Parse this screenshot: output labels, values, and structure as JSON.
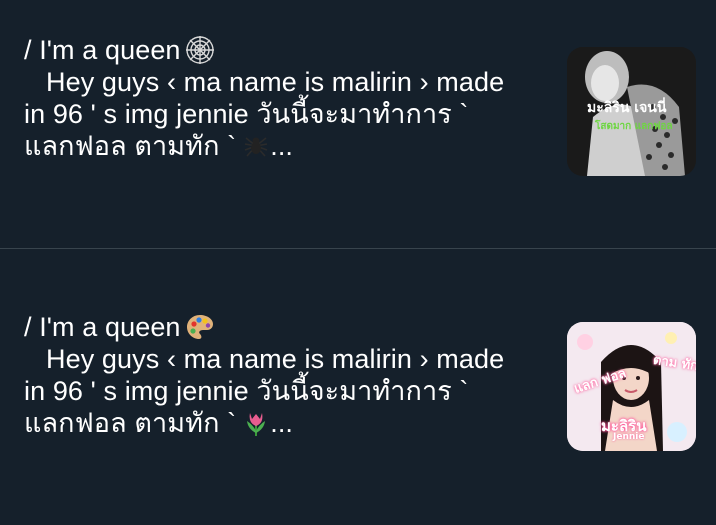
{
  "posts": [
    {
      "title": "/ I'm a queen",
      "title_emoji": "spider-web-icon",
      "line1": "Hey guys ‹ ma name is malirin › made",
      "line2": "in 96 ' s img jennie วันนี้จะมาทำการ `",
      "line3": "แลกฟอล ตามทัก `",
      "line3_emoji": "spider-icon",
      "ellipsis": "...",
      "thumbnail": {
        "overlay_main": "มะลิริน เจนนี่",
        "overlay_sub": "โสดมาก แลกฟอล"
      }
    },
    {
      "title": "/ I'm a queen",
      "title_emoji": "palette-icon",
      "line1": "Hey guys ‹ ma name is malirin › made",
      "line2": "in 96 ' s img jennie วันนี้จะมาทำการ `",
      "line3": "แลกฟอล ตามทัก `",
      "line3_emoji": "tulip-icon",
      "ellipsis": "...",
      "thumbnail": {
        "overlay_left": "แลก ฟอล",
        "overlay_right": "ตาม ทัก",
        "overlay_center": "มะลิริน",
        "overlay_sub": "Jennie"
      }
    }
  ],
  "colors": {
    "background": "#15202b",
    "divider": "#38444d",
    "text": "#ffffff",
    "thumb1_accent": "#6dd641",
    "thumb2_accent": "#ff6fa8"
  }
}
